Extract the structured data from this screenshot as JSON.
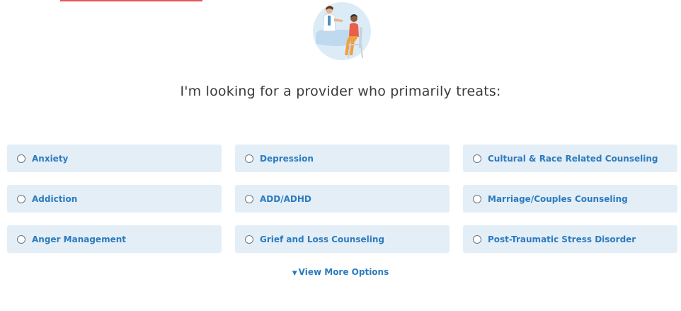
{
  "heading": "I'm looking for a provider who primarily treats:",
  "options": [
    {
      "label": "Anxiety"
    },
    {
      "label": "Depression"
    },
    {
      "label": "Cultural & Race Related Counseling"
    },
    {
      "label": "Addiction"
    },
    {
      "label": "ADD/ADHD"
    },
    {
      "label": "Marriage/Couples Counseling"
    },
    {
      "label": "Anger Management"
    },
    {
      "label": "Grief and Loss Counseling"
    },
    {
      "label": "Post-Traumatic Stress Disorder"
    }
  ],
  "view_more": {
    "icon": "caret-down-icon",
    "label": "View More Options"
  },
  "colors": {
    "accent": "#2b7bbf",
    "option_background": "#e4eef6",
    "top_bar": "#e8545b",
    "heading_text": "#3a3a3a"
  }
}
